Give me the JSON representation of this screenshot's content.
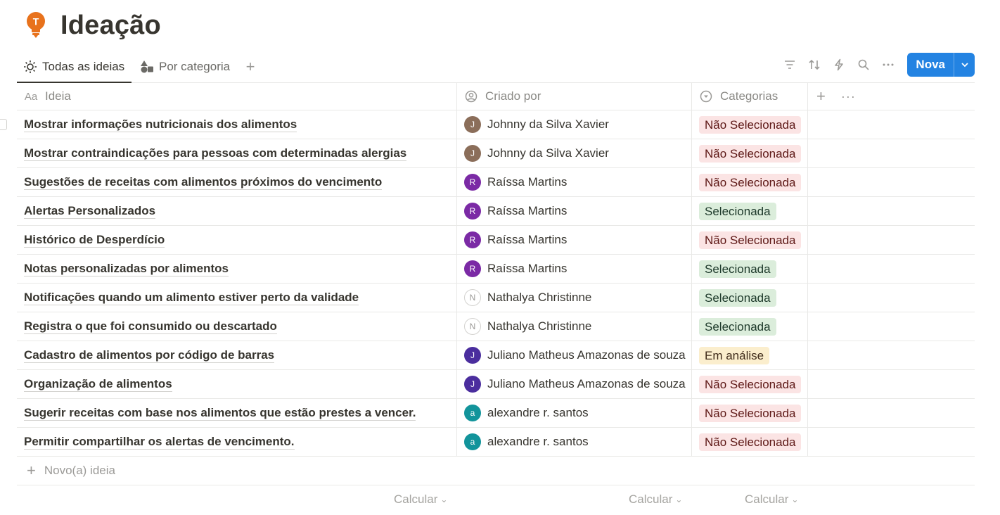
{
  "page": {
    "title": "Ideação",
    "icon": "lightbulb-t-icon"
  },
  "tabs": [
    {
      "label": "Todas as ideias",
      "icon": "sun-icon",
      "active": true
    },
    {
      "label": "Por categoria",
      "icon": "shapes-icon",
      "active": false
    }
  ],
  "toolbar": {
    "icons": [
      "filter-icon",
      "sort-icon",
      "automation-icon",
      "search-icon",
      "more-icon"
    ],
    "new_label": "Nova"
  },
  "columns": [
    {
      "label": "Ideia",
      "icon_text": "Aa"
    },
    {
      "label": "Criado por",
      "icon": "person-circle-icon"
    },
    {
      "label": "Categorias",
      "icon": "select-icon"
    }
  ],
  "colors": {
    "accent": "#2383e2",
    "tag_red_bg": "#fbe4e4",
    "tag_red_fg": "#5d1715",
    "tag_green_bg": "#dbeddb",
    "tag_green_fg": "#1c3829",
    "tag_yellow_bg": "#fbeecd",
    "tag_yellow_fg": "#402c1b"
  },
  "rows": [
    {
      "idea": "Mostrar informações nutricionais dos alimentos",
      "initial": "J",
      "avatar_color": "#8b6e5a",
      "author": "Johnny da Silva Xavier",
      "category": "Não Selecionada",
      "tag": "red"
    },
    {
      "idea": "Mostrar contraindicações para pessoas com determinadas alergias",
      "initial": "J",
      "avatar_color": "#8b6e5a",
      "author": "Johnny da Silva Xavier",
      "category": "Não Selecionada",
      "tag": "red"
    },
    {
      "idea": "Sugestões de receitas com alimentos próximos do vencimento",
      "initial": "R",
      "avatar_color": "#7b2aa5",
      "author": "Raíssa Martins",
      "category": "Não Selecionada",
      "tag": "red"
    },
    {
      "idea": "Alertas Personalizados",
      "initial": "R",
      "avatar_color": "#7b2aa5",
      "author": "Raíssa Martins",
      "category": "Selecionada",
      "tag": "green"
    },
    {
      "idea": "Histórico de Desperdício",
      "initial": "R",
      "avatar_color": "#7b2aa5",
      "author": "Raíssa Martins",
      "category": "Não Selecionada",
      "tag": "red"
    },
    {
      "idea": "Notas personalizadas por alimentos",
      "initial": "R",
      "avatar_color": "#7b2aa5",
      "author": "Raíssa Martins",
      "category": "Selecionada",
      "tag": "green"
    },
    {
      "idea": "Notificações quando um alimento estiver perto da validade",
      "initial": "N",
      "avatar_color": "outline",
      "author": "Nathalya Christinne",
      "category": "Selecionada",
      "tag": "green"
    },
    {
      "idea": "Registra o que foi consumido ou descartado",
      "initial": "N",
      "avatar_color": "outline",
      "author": "Nathalya Christinne",
      "category": "Selecionada",
      "tag": "green"
    },
    {
      "idea": "Cadastro de alimentos por código de barras",
      "initial": "J",
      "avatar_color": "#4b2e9e",
      "author": "Juliano Matheus Amazonas de souza",
      "category": "Em análise",
      "tag": "yellow"
    },
    {
      "idea": "Organização de alimentos",
      "initial": "J",
      "avatar_color": "#4b2e9e",
      "author": "Juliano Matheus Amazonas de souza",
      "category": "Não Selecionada",
      "tag": "red"
    },
    {
      "idea": "Sugerir receitas com base nos alimentos que estão prestes a vencer.",
      "initial": "a",
      "avatar_color": "#12949b",
      "author": "alexandre r. santos",
      "category": "Não Selecionada",
      "tag": "red"
    },
    {
      "idea": "Permitir compartilhar os alertas de vencimento.",
      "initial": "a",
      "avatar_color": "#12949b",
      "author": "alexandre r. santos",
      "category": "Não Selecionada",
      "tag": "red"
    }
  ],
  "new_row_label": "Novo(a) ideia",
  "calculate_label": "Calcular"
}
